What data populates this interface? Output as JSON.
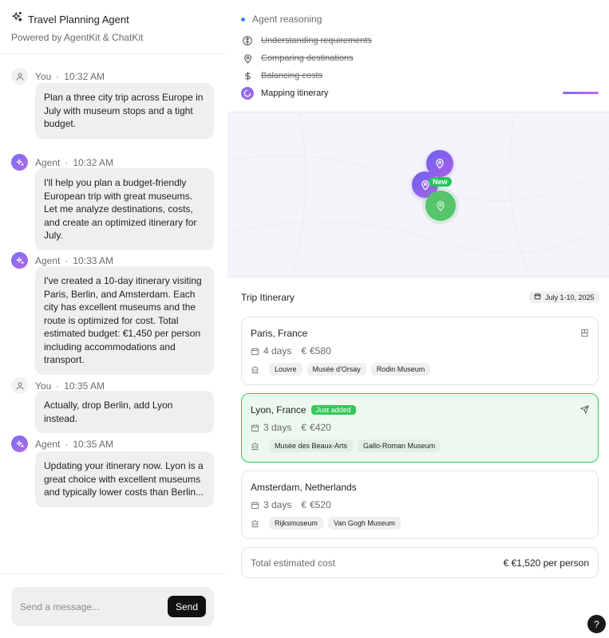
{
  "header": {
    "title": "Travel Planning Agent",
    "subtitle": "Powered by AgentKit & ChatKit"
  },
  "messages": [
    {
      "role": "user",
      "author": "You",
      "time": "10:32 AM",
      "text": "Plan a three city trip across Europe in July with museum stops and a tight budget."
    },
    {
      "role": "agent",
      "author": "Agent",
      "time": "10:32 AM",
      "text": "I'll help you plan a budget-friendly European trip with great museums. Let me analyze destinations, costs, and create an optimized itinerary for July."
    },
    {
      "role": "agent",
      "author": "Agent",
      "time": "10:33 AM",
      "text": "I've created a 10-day itinerary visiting Paris, Berlin, and Amsterdam. Each city has excellent museums and the route is optimized for cost. Total estimated budget: €1,450 per person including accommodations and transport."
    },
    {
      "role": "user",
      "author": "You",
      "time": "10:35 AM",
      "text": "Actually, drop Berlin, add Lyon instead."
    },
    {
      "role": "agent",
      "author": "Agent",
      "time": "10:35 AM",
      "text": "Updating your itinerary now. Lyon is a great choice with excellent museums and typically lower costs than Berlin..."
    }
  ],
  "composer": {
    "placeholder": "Send a message...",
    "send_label": "Send"
  },
  "reasoning": {
    "heading": "Agent reasoning",
    "steps": [
      {
        "label": "Understanding requirements",
        "status": "done",
        "icon": "brain-icon"
      },
      {
        "label": "Comparing destinations",
        "status": "done",
        "icon": "map-pin-icon"
      },
      {
        "label": "Balancing costs",
        "status": "done",
        "icon": "dollar-icon"
      },
      {
        "label": "Mapping itinerary",
        "status": "active",
        "icon": "spinner-icon"
      }
    ]
  },
  "map": {
    "new_label": "New"
  },
  "itinerary": {
    "title": "Trip Itinerary",
    "date_range": "July 1-10, 2025",
    "cities": [
      {
        "name": "Paris, France",
        "days": "4 days",
        "cost": "€580",
        "museums": [
          "Louvre",
          "Musée d'Orsay",
          "Rodin Museum"
        ],
        "badge": "",
        "corner_icon": "bookmark-icon"
      },
      {
        "name": "Lyon, France",
        "days": "3 days",
        "cost": "€420",
        "museums": [
          "Musée des Beaux-Arts",
          "Gallo-Roman Museum"
        ],
        "badge": "Just added",
        "corner_icon": "plane-icon"
      },
      {
        "name": "Amsterdam, Netherlands",
        "days": "3 days",
        "cost": "€520",
        "museums": [
          "Rijksmuseum",
          "Van Gogh Museum"
        ],
        "badge": "",
        "corner_icon": ""
      }
    ],
    "currency_symbol": "€",
    "total_label": "Total estimated cost",
    "total_value": "€1,520 per person"
  },
  "help_label": "?",
  "colors": {
    "accent_purple": "#7a6cf5",
    "accent_green": "#34c759",
    "send_button": "#111111"
  }
}
